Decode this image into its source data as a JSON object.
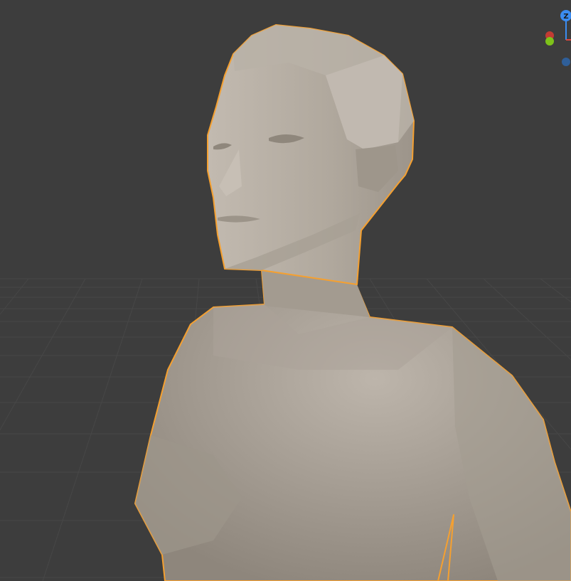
{
  "viewport": {
    "background": "#3d3d3d",
    "grid_color": "#474747",
    "selection_outline": "#f5a030",
    "mesh_color": "#b6aea4"
  },
  "gizmo": {
    "z_label": "Z",
    "z_color": "#3b8cf0",
    "x_color": "#e0463d",
    "y_color": "#7ec21a",
    "neg_color": "#2f5f99"
  }
}
